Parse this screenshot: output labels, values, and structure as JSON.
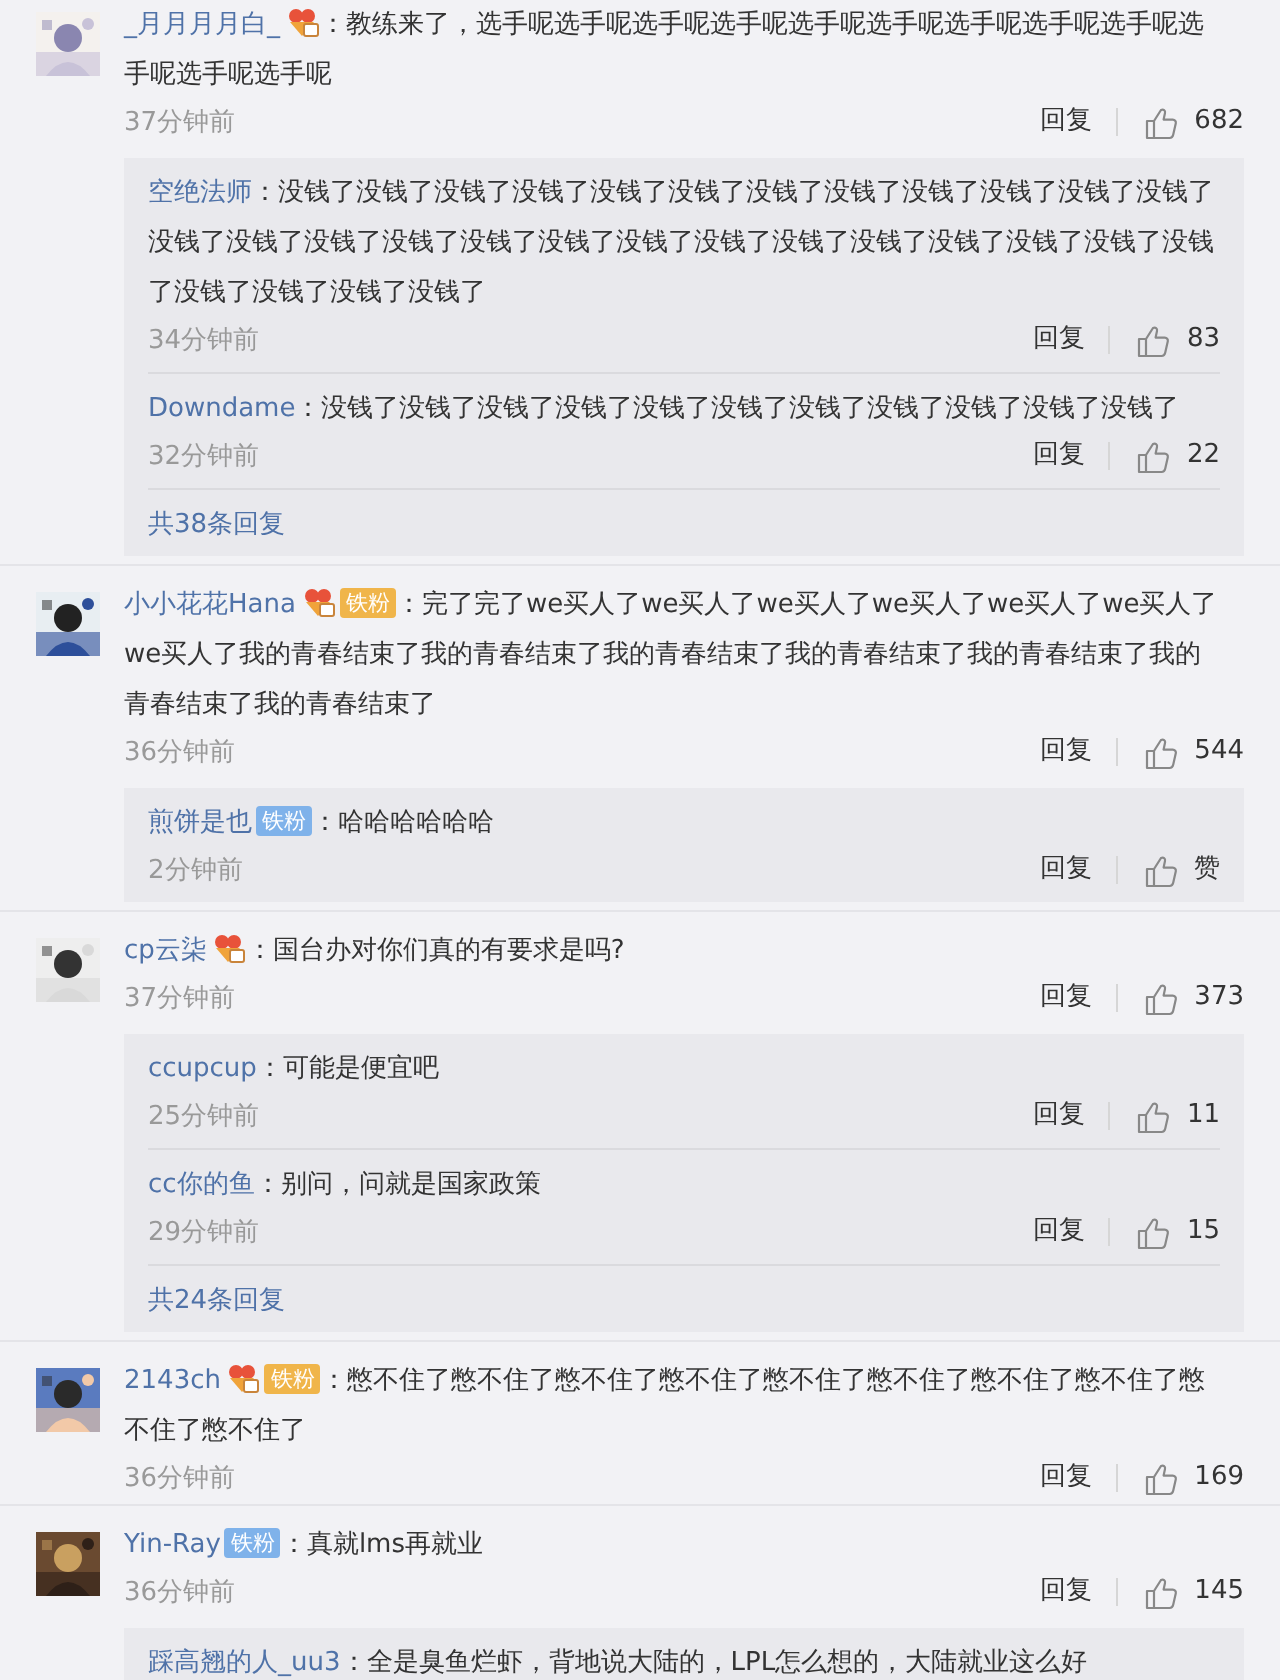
{
  "comments": [
    {
      "user": "_月月月月白_",
      "vip": true,
      "text": "：教练来了，选手呢选手呢选手呢选手呢选手呢选手呢选手呢选手呢选手呢选手呢选手呢选手呢",
      "time": "37分钟前",
      "reply_label": "回复",
      "likes": "682",
      "replies": [
        {
          "user": "空绝法师",
          "text": "：没钱了没钱了没钱了没钱了没钱了没钱了没钱了没钱了没钱了没钱了没钱了没钱了没钱了没钱了没钱了没钱了没钱了没钱了没钱了没钱了没钱了没钱了没钱了没钱了没钱了没钱了没钱了没钱了没钱了没钱了",
          "time": "34分钟前",
          "reply_label": "回复",
          "likes": "83"
        },
        {
          "user": "Downdame",
          "text": "：没钱了没钱了没钱了没钱了没钱了没钱了没钱了没钱了没钱了没钱了没钱了",
          "time": "32分钟前",
          "reply_label": "回复",
          "likes": "22"
        }
      ],
      "more_replies": "共38条回复"
    },
    {
      "user": "小小花花Hana",
      "vip": true,
      "badge": {
        "label": "铁粉",
        "color": "#f0b54a"
      },
      "text": "：完了完了we买人了we买人了we买人了we买人了we买人了we买人了we买人了我的青春结束了我的青春结束了我的青春结束了我的青春结束了我的青春结束了我的青春结束了我的青春结束了",
      "time": "36分钟前",
      "reply_label": "回复",
      "likes": "544",
      "replies": [
        {
          "user": "煎饼是也",
          "badge": {
            "label": "铁粉",
            "color": "#7fb2ea"
          },
          "text": "：哈哈哈哈哈哈",
          "time": "2分钟前",
          "reply_label": "回复",
          "likes": "赞"
        }
      ]
    },
    {
      "user": "cp云柒",
      "vip": true,
      "text": "：国台办对你们真的有要求是吗?",
      "time": "37分钟前",
      "reply_label": "回复",
      "likes": "373",
      "replies": [
        {
          "user": "ccupcup",
          "text": "：可能是便宜吧",
          "time": "25分钟前",
          "reply_label": "回复",
          "likes": "11"
        },
        {
          "user": "cc你的鱼",
          "text": "：别问，问就是国家政策",
          "time": "29分钟前",
          "reply_label": "回复",
          "likes": "15"
        }
      ],
      "more_replies": "共24条回复"
    },
    {
      "user": "2143ch",
      "vip": true,
      "badge": {
        "label": "铁粉",
        "color": "#f0b54a"
      },
      "text": "：憋不住了憋不住了憋不住了憋不住了憋不住了憋不住了憋不住了憋不住了憋不住了憋不住了",
      "time": "36分钟前",
      "reply_label": "回复",
      "likes": "169"
    },
    {
      "user": "Yin-Ray",
      "badge": {
        "label": "铁粉",
        "color": "#7fb2ea"
      },
      "text": "：真就lms再就业",
      "time": "36分钟前",
      "reply_label": "回复",
      "likes": "145",
      "replies": [
        {
          "user": "踩高翘的人_uu3",
          "text": "：全是臭鱼烂虾，背地说大陆的，LPL怎么想的，大陆就业这么好"
        }
      ]
    }
  ]
}
